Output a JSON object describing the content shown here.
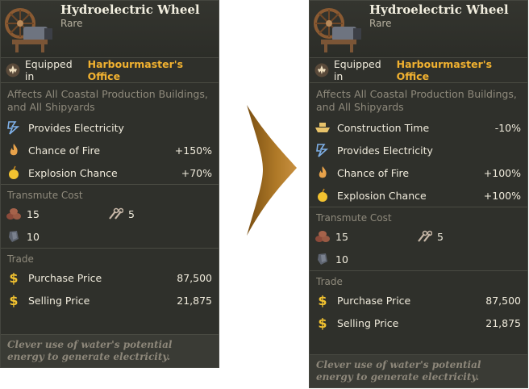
{
  "before": {
    "title": "Hydroelectric Wheel",
    "rarity": "Rare",
    "equipped_prefix": "Equipped in",
    "equipped_location": "Harbourmaster's Office",
    "affects": "Affects All Coastal Production Buildings, and All Shipyards",
    "effects": [
      {
        "icon": "lightning-icon",
        "label": "Provides Electricity",
        "value": ""
      },
      {
        "icon": "fire-icon",
        "label": "Chance of Fire",
        "value": "+150%"
      },
      {
        "icon": "bomb-icon",
        "label": "Explosion Chance",
        "value": "+70%"
      }
    ],
    "transmute_title": "Transmute Cost",
    "transmute": [
      {
        "icon": "wood-pile-icon",
        "value": "15"
      },
      {
        "icon": "wrench-tools-icon",
        "value": "5"
      },
      {
        "icon": "metal-plate-icon",
        "value": "10"
      }
    ],
    "trade_title": "Trade",
    "trade": [
      {
        "icon": "dollar-icon",
        "label": "Purchase Price",
        "value": "87,500"
      },
      {
        "icon": "dollar-icon",
        "label": "Selling Price",
        "value": "21,875"
      }
    ],
    "flavor": "Clever use of water's potential energy to generate electricity."
  },
  "after": {
    "title": "Hydroelectric Wheel",
    "rarity": "Rare",
    "equipped_prefix": "Equipped in",
    "equipped_location": "Harbourmaster's Office",
    "affects": "Affects All Coastal Production Buildings, and All Shipyards",
    "effects": [
      {
        "icon": "ship-icon",
        "label": "Construction Time",
        "value": "-10%"
      },
      {
        "icon": "lightning-icon",
        "label": "Provides Electricity",
        "value": ""
      },
      {
        "icon": "fire-icon",
        "label": "Chance of Fire",
        "value": "+100%"
      },
      {
        "icon": "bomb-icon",
        "label": "Explosion Chance",
        "value": "+100%"
      }
    ],
    "transmute_title": "Transmute Cost",
    "transmute": [
      {
        "icon": "wood-pile-icon",
        "value": "15"
      },
      {
        "icon": "wrench-tools-icon",
        "value": "5"
      },
      {
        "icon": "metal-plate-icon",
        "value": "10"
      }
    ],
    "trade_title": "Trade",
    "trade": [
      {
        "icon": "dollar-icon",
        "label": "Purchase Price",
        "value": "87,500"
      },
      {
        "icon": "dollar-icon",
        "label": "Selling Price",
        "value": "21,875"
      }
    ],
    "flavor": "Clever use of water's potential energy to generate electricity."
  },
  "colors": {
    "panel": "#2f302b",
    "accent_location": "#f2b230",
    "arrow": "#a06a1c"
  }
}
